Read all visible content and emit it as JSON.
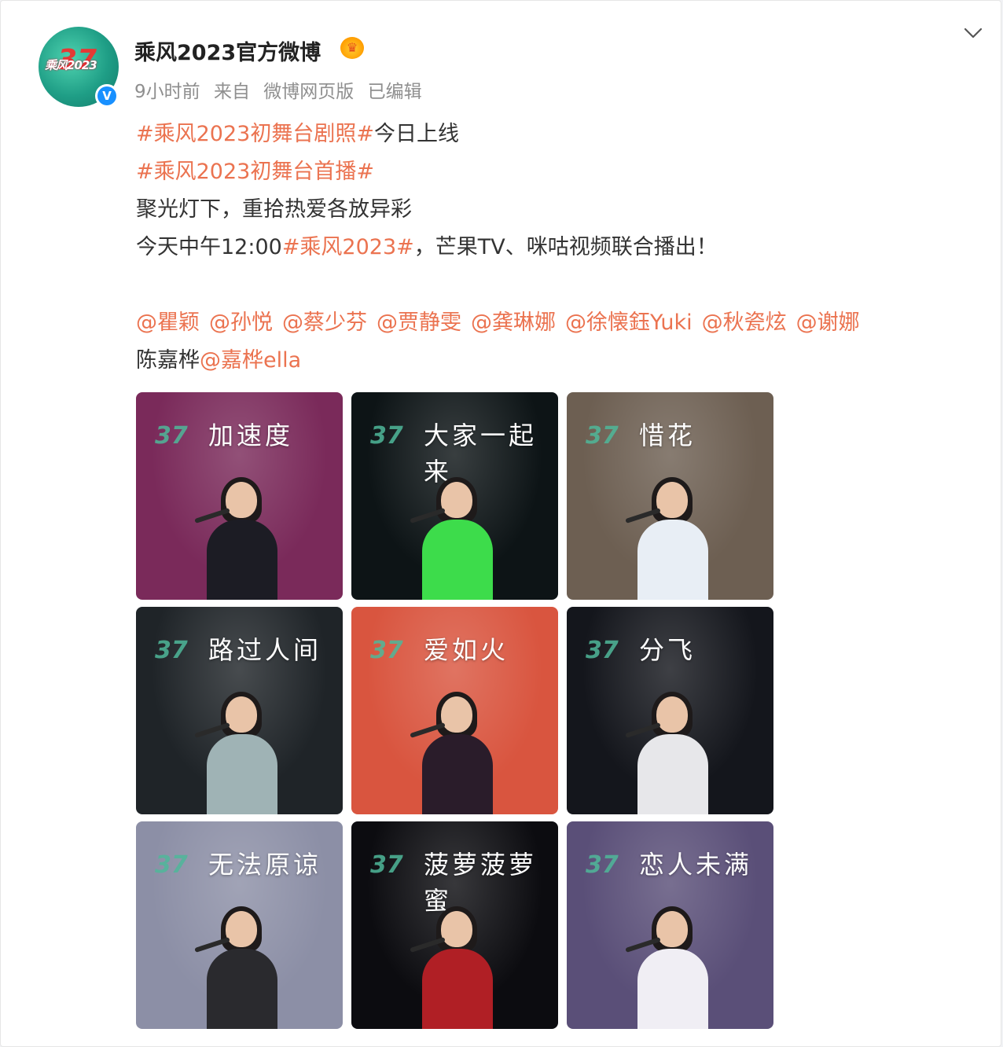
{
  "post": {
    "username": "乘风2023官方微博",
    "avatar_label": "乘风2023",
    "meta": {
      "time": "9小时前",
      "source_prefix": "来自",
      "source": "微博网页版",
      "edited": "已编辑"
    },
    "text": {
      "line1_tag": "#乘风2023初舞台剧照#",
      "line1_text": "今日上线",
      "line2_tag": "#乘风2023初舞台首播#",
      "line3": "聚光灯下，重拾热爱各放异彩",
      "line4_pre": "今天中午12:00",
      "line4_tag": "#乘风2023#",
      "line4_post": "，芒果TV、咪咕视频联合播出！"
    },
    "mentions": [
      "@瞿颖",
      "@孙悦",
      "@蔡少芬",
      "@贾静雯",
      "@龚琳娜",
      "@徐懐鈺Yuki",
      "@秋瓷炫",
      "@谢娜"
    ],
    "mention_line2_plain": "陈嘉桦",
    "mention_line2_link": "@嘉桦ella"
  },
  "images": [
    {
      "title": "加速度",
      "bg": "#7a2a5a",
      "body": "#1c1c24"
    },
    {
      "title": "大家一起来",
      "bg": "#0d1416",
      "body": "#3ddc4b"
    },
    {
      "title": "惜花",
      "bg": "#6d5f52",
      "body": "#e8eef5"
    },
    {
      "title": "路过人间",
      "bg": "#1f2428",
      "body": "#9fb3b5"
    },
    {
      "title": "爱如火",
      "bg": "#d9553f",
      "body": "#2a1c2a"
    },
    {
      "title": "分飞",
      "bg": "#14161c",
      "body": "#e7e7ea"
    },
    {
      "title": "无法原谅",
      "bg": "#8c8fa6",
      "body": "#2a2a2e"
    },
    {
      "title": "菠萝菠萝蜜",
      "bg": "#0c0c10",
      "body": "#b01f25"
    },
    {
      "title": "恋人未满",
      "bg": "#5a4f78",
      "body": "#f0eef4"
    }
  ],
  "colors": {
    "link": "#eb7350",
    "verified": "#1890ff"
  },
  "icons": {
    "verified": "verified-badge-icon",
    "crown": "crown-icon",
    "expand": "chevron-down-icon"
  }
}
